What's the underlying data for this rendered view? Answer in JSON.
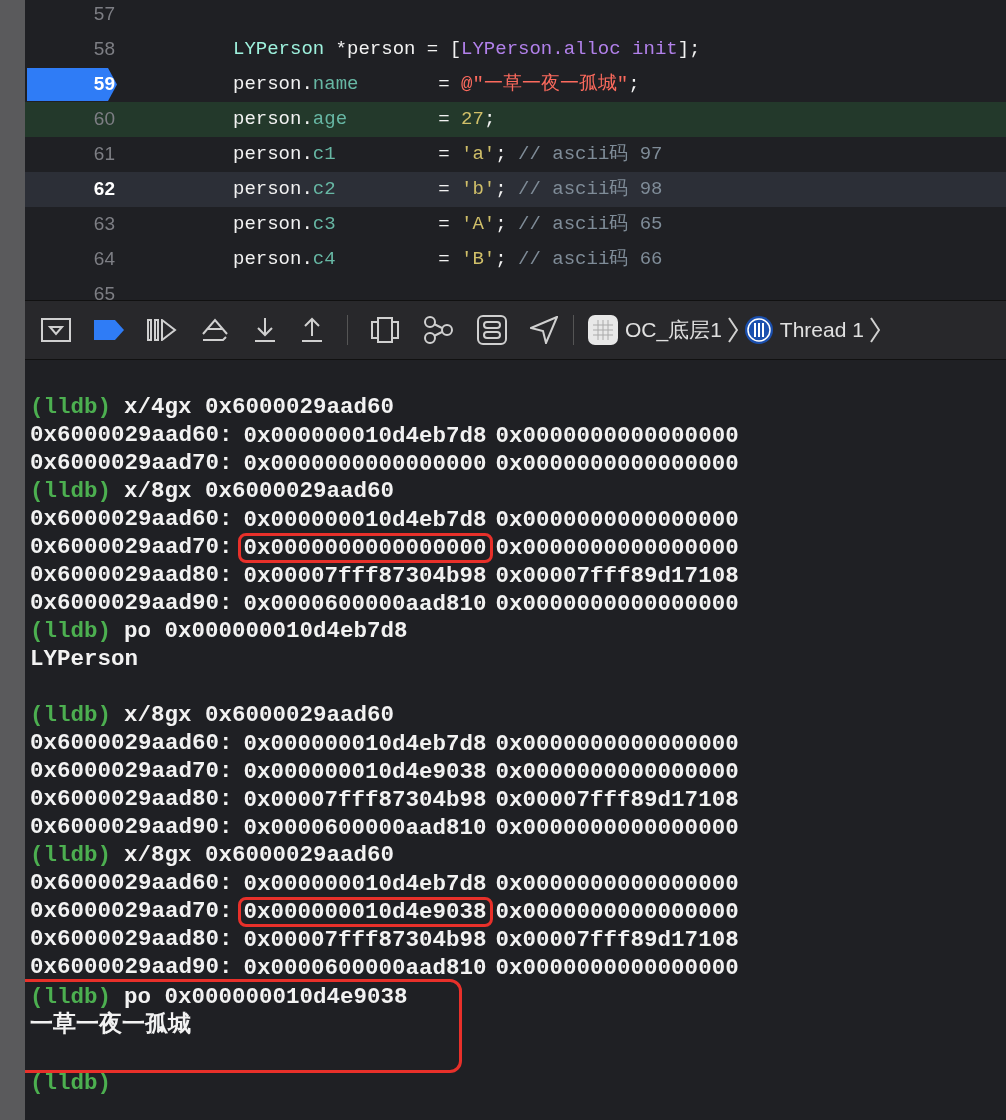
{
  "editor": {
    "lines": [
      {
        "number": "57",
        "kind": "normal"
      },
      {
        "number": "58",
        "kind": "normal",
        "tokens": [
          {
            "text": "LYPerson",
            "kind": "type"
          },
          {
            "text": " *person = [",
            "kind": "plain"
          },
          {
            "text": "LYPerson.alloc init",
            "kind": "method"
          },
          {
            "text": "];",
            "kind": "plain"
          }
        ]
      },
      {
        "number": "59",
        "kind": "breakpoint",
        "tokens": [
          {
            "text": "person.",
            "kind": "plain"
          },
          {
            "text": "name",
            "kind": "prop"
          },
          {
            "text": "       = ",
            "kind": "plain"
          },
          {
            "text": "@\"一草一夜一孤城\"",
            "kind": "string"
          },
          {
            "text": ";",
            "kind": "plain"
          }
        ]
      },
      {
        "number": "60",
        "kind": "executing",
        "tokens": [
          {
            "text": "person.",
            "kind": "plain"
          },
          {
            "text": "age",
            "kind": "prop"
          },
          {
            "text": "        = ",
            "kind": "plain"
          },
          {
            "text": "27",
            "kind": "number"
          },
          {
            "text": ";",
            "kind": "plain"
          }
        ]
      },
      {
        "number": "61",
        "kind": "normal",
        "tokens": [
          {
            "text": "person.",
            "kind": "plain"
          },
          {
            "text": "c1",
            "kind": "prop"
          },
          {
            "text": "         = ",
            "kind": "plain"
          },
          {
            "text": "'a'",
            "kind": "number"
          },
          {
            "text": "; ",
            "kind": "plain"
          },
          {
            "text": "// ascii码 97",
            "kind": "comment"
          }
        ]
      },
      {
        "number": "62",
        "kind": "cursor",
        "tokens": [
          {
            "text": "person.",
            "kind": "plain"
          },
          {
            "text": "c2",
            "kind": "prop"
          },
          {
            "text": "         = ",
            "kind": "plain"
          },
          {
            "text": "'b'",
            "kind": "number"
          },
          {
            "text": "; ",
            "kind": "plain"
          },
          {
            "text": "// ascii码 98",
            "kind": "comment"
          }
        ]
      },
      {
        "number": "63",
        "kind": "normal",
        "tokens": [
          {
            "text": "person.",
            "kind": "plain"
          },
          {
            "text": "c3",
            "kind": "prop"
          },
          {
            "text": "         = ",
            "kind": "plain"
          },
          {
            "text": "'A'",
            "kind": "number"
          },
          {
            "text": "; ",
            "kind": "plain"
          },
          {
            "text": "// ascii码 65",
            "kind": "comment"
          }
        ]
      },
      {
        "number": "64",
        "kind": "normal",
        "tokens": [
          {
            "text": "person.",
            "kind": "plain"
          },
          {
            "text": "c4",
            "kind": "prop"
          },
          {
            "text": "         = ",
            "kind": "plain"
          },
          {
            "text": "'B'",
            "kind": "number"
          },
          {
            "text": "; ",
            "kind": "plain"
          },
          {
            "text": "// ascii码 66",
            "kind": "comment"
          }
        ]
      },
      {
        "number": "65",
        "kind": "normal"
      }
    ]
  },
  "debug_bar": {
    "scheme": "OC_底层1",
    "thread": "Thread 1"
  },
  "console": {
    "lines": [
      {
        "kind": "prompt",
        "prompt": "(lldb)",
        "command": "x/4gx 0x6000029aad60"
      },
      {
        "kind": "memory",
        "address": "0x6000029aad60:",
        "words": [
          {
            "text": "0x000000010d4eb7d8",
            "circled": false
          },
          {
            "text": "0x0000000000000000",
            "circled": false
          }
        ]
      },
      {
        "kind": "memory",
        "address": "0x6000029aad70:",
        "words": [
          {
            "text": "0x0000000000000000",
            "circled": false
          },
          {
            "text": "0x0000000000000000",
            "circled": false
          }
        ]
      },
      {
        "kind": "prompt",
        "prompt": "(lldb)",
        "command": "x/8gx 0x6000029aad60"
      },
      {
        "kind": "memory",
        "address": "0x6000029aad60:",
        "words": [
          {
            "text": "0x000000010d4eb7d8",
            "circled": false
          },
          {
            "text": "0x0000000000000000",
            "circled": false
          }
        ]
      },
      {
        "kind": "memory",
        "address": "0x6000029aad70:",
        "words": [
          {
            "text": "0x0000000000000000",
            "circled": true
          },
          {
            "text": "0x0000000000000000",
            "circled": false
          }
        ]
      },
      {
        "kind": "memory",
        "address": "0x6000029aad80:",
        "words": [
          {
            "text": "0x00007fff87304b98",
            "circled": false
          },
          {
            "text": "0x00007fff89d17108",
            "circled": false
          }
        ]
      },
      {
        "kind": "memory",
        "address": "0x6000029aad90:",
        "words": [
          {
            "text": "0x0000600000aad810",
            "circled": false
          },
          {
            "text": "0x0000000000000000",
            "circled": false
          }
        ]
      },
      {
        "kind": "prompt",
        "prompt": "(lldb)",
        "command": "po 0x000000010d4eb7d8"
      },
      {
        "kind": "output",
        "text": "LYPerson"
      },
      {
        "kind": "blank"
      },
      {
        "kind": "prompt",
        "prompt": "(lldb)",
        "command": "x/8gx 0x6000029aad60"
      },
      {
        "kind": "memory",
        "address": "0x6000029aad60:",
        "words": [
          {
            "text": "0x000000010d4eb7d8",
            "circled": false
          },
          {
            "text": "0x0000000000000000",
            "circled": false
          }
        ]
      },
      {
        "kind": "memory",
        "address": "0x6000029aad70:",
        "words": [
          {
            "text": "0x000000010d4e9038",
            "circled": false
          },
          {
            "text": "0x0000000000000000",
            "circled": false
          }
        ]
      },
      {
        "kind": "memory",
        "address": "0x6000029aad80:",
        "words": [
          {
            "text": "0x00007fff87304b98",
            "circled": false
          },
          {
            "text": "0x00007fff89d17108",
            "circled": false
          }
        ]
      },
      {
        "kind": "memory",
        "address": "0x6000029aad90:",
        "words": [
          {
            "text": "0x0000600000aad810",
            "circled": false
          },
          {
            "text": "0x0000000000000000",
            "circled": false
          }
        ]
      },
      {
        "kind": "prompt",
        "prompt": "(lldb)",
        "command": "x/8gx 0x6000029aad60"
      },
      {
        "kind": "memory",
        "address": "0x6000029aad60:",
        "words": [
          {
            "text": "0x000000010d4eb7d8",
            "circled": false
          },
          {
            "text": "0x0000000000000000",
            "circled": false
          }
        ]
      },
      {
        "kind": "memory",
        "address": "0x6000029aad70:",
        "words": [
          {
            "text": "0x000000010d4e9038",
            "circled": true
          },
          {
            "text": "0x0000000000000000",
            "circled": false
          }
        ]
      },
      {
        "kind": "memory",
        "address": "0x6000029aad80:",
        "words": [
          {
            "text": "0x00007fff87304b98",
            "circled": false
          },
          {
            "text": "0x00007fff89d17108",
            "circled": false
          }
        ]
      },
      {
        "kind": "memory",
        "address": "0x6000029aad90:",
        "words": [
          {
            "text": "0x0000600000aad810",
            "circled": false
          },
          {
            "text": "0x0000000000000000",
            "circled": false
          }
        ]
      },
      {
        "kind": "boxed_group",
        "lines": [
          {
            "kind": "prompt",
            "prompt": "(lldb)",
            "command": "po 0x000000010d4e9038"
          },
          {
            "kind": "output",
            "text": "一草一夜一孤城"
          },
          {
            "kind": "blank"
          }
        ]
      },
      {
        "kind": "prompt",
        "prompt": "(lldb)"
      }
    ]
  }
}
